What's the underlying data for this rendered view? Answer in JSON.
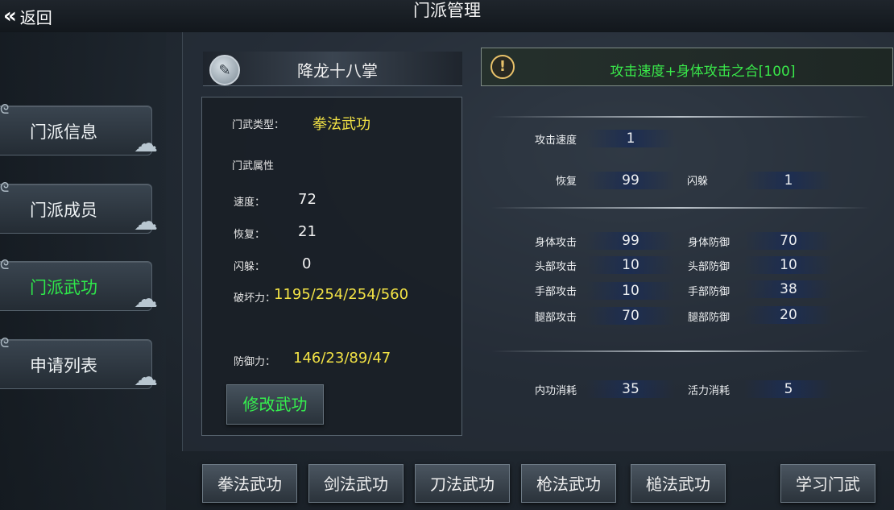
{
  "header": {
    "back_label": "返回",
    "title": "门派管理"
  },
  "sidebar": {
    "items": [
      {
        "label": "门派信息",
        "active": false
      },
      {
        "label": "门派成员",
        "active": false
      },
      {
        "label": "门派武功",
        "active": true
      },
      {
        "label": "申请列表",
        "active": false
      }
    ]
  },
  "skill": {
    "name": "降龙十八掌"
  },
  "notice": {
    "text": "攻击速度+身体攻击之合[100]"
  },
  "info": {
    "type_label": "门武类型：",
    "type_value": "拳法武功",
    "attr_label": "门武属性",
    "speed_label": "速度：",
    "speed_value": "72",
    "recover_label": "恢复：",
    "recover_value": "21",
    "dodge_label": "闪躲：",
    "dodge_value": "0",
    "destroy_label": "破坏力：",
    "destroy_value": "1195/254/254/560",
    "defense_label": "防御力：",
    "defense_value": "146/23/89/47",
    "edit_button": "修改武功"
  },
  "stats": {
    "attack_speed": {
      "label": "攻击速度",
      "value": "1"
    },
    "recover": {
      "label": "恢复",
      "value": "99"
    },
    "dodge": {
      "label": "闪躲",
      "value": "1"
    },
    "body_attack": {
      "label": "身体攻击",
      "value": "99"
    },
    "body_defense": {
      "label": "身体防御",
      "value": "70"
    },
    "head_attack": {
      "label": "头部攻击",
      "value": "10"
    },
    "head_defense": {
      "label": "头部防御",
      "value": "10"
    },
    "hand_attack": {
      "label": "手部攻击",
      "value": "10"
    },
    "hand_defense": {
      "label": "手部防御",
      "value": "38"
    },
    "leg_attack": {
      "label": "腿部攻击",
      "value": "70"
    },
    "leg_defense": {
      "label": "腿部防御",
      "value": "20"
    },
    "inner_cost": {
      "label": "内功消耗",
      "value": "35"
    },
    "vigor_cost": {
      "label": "活力消耗",
      "value": "5"
    }
  },
  "bottom": {
    "fist": "拳法武功",
    "sword": "剑法武功",
    "blade": "刀法武功",
    "spear": "枪法武功",
    "club": "槌法武功",
    "learn": "学习门武"
  },
  "colors": {
    "active_green": "#2ee84a",
    "value_yellow": "#f2e245",
    "notice_green": "#39e84a"
  }
}
